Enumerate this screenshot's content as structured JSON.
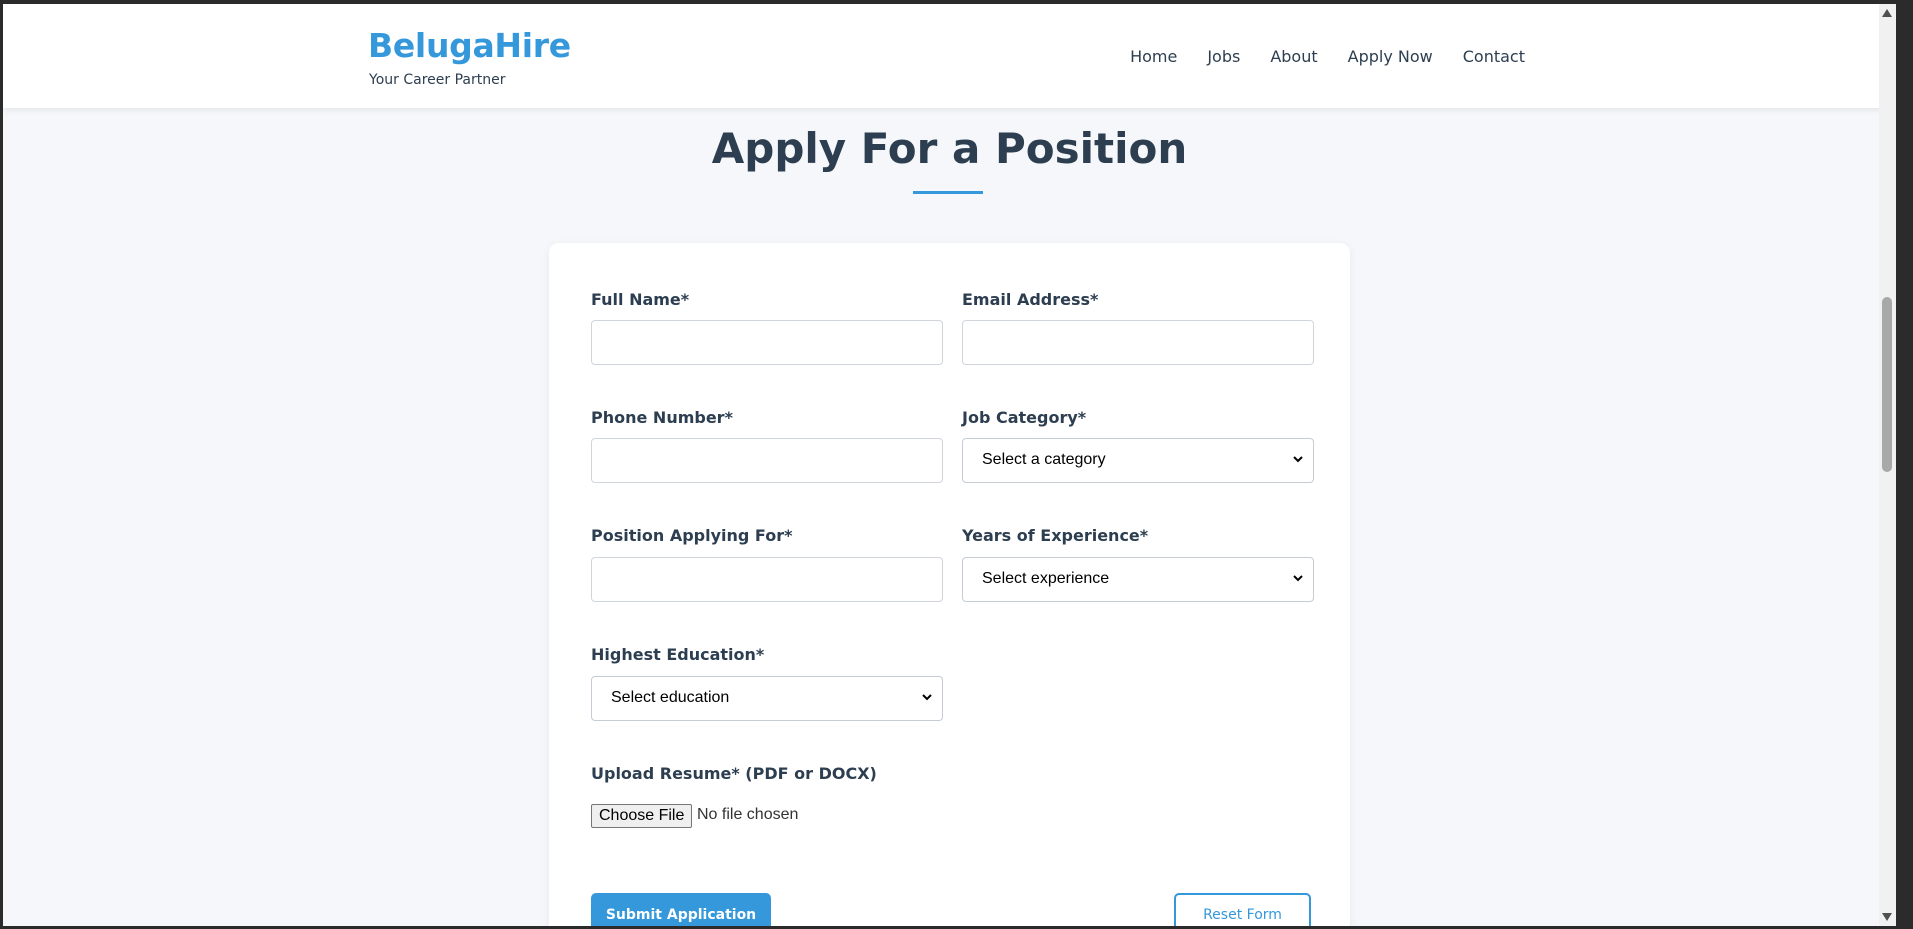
{
  "brand": {
    "name": "BelugaHire",
    "tagline": "Your Career Partner",
    "accent_color": "#3498db",
    "text_color": "#2c3e50"
  },
  "nav": {
    "items": [
      {
        "label": "Home"
      },
      {
        "label": "Jobs"
      },
      {
        "label": "About"
      },
      {
        "label": "Apply Now"
      },
      {
        "label": "Contact"
      }
    ]
  },
  "page": {
    "title": "Apply For a Position"
  },
  "form": {
    "full_name": {
      "label": "Full Name*",
      "value": ""
    },
    "email": {
      "label": "Email Address*",
      "value": ""
    },
    "phone": {
      "label": "Phone Number*",
      "value": ""
    },
    "job_category": {
      "label": "Job Category*",
      "selected": "Select a category"
    },
    "position": {
      "label": "Position Applying For*",
      "value": ""
    },
    "experience": {
      "label": "Years of Experience*",
      "selected": "Select experience"
    },
    "education": {
      "label": "Highest Education*",
      "selected": "Select education"
    },
    "resume": {
      "label": "Upload Resume* (PDF or DOCX)",
      "button_label": "Choose File",
      "status": "No file chosen"
    },
    "submit_label": "Submit Application",
    "reset_label": "Reset Form"
  }
}
